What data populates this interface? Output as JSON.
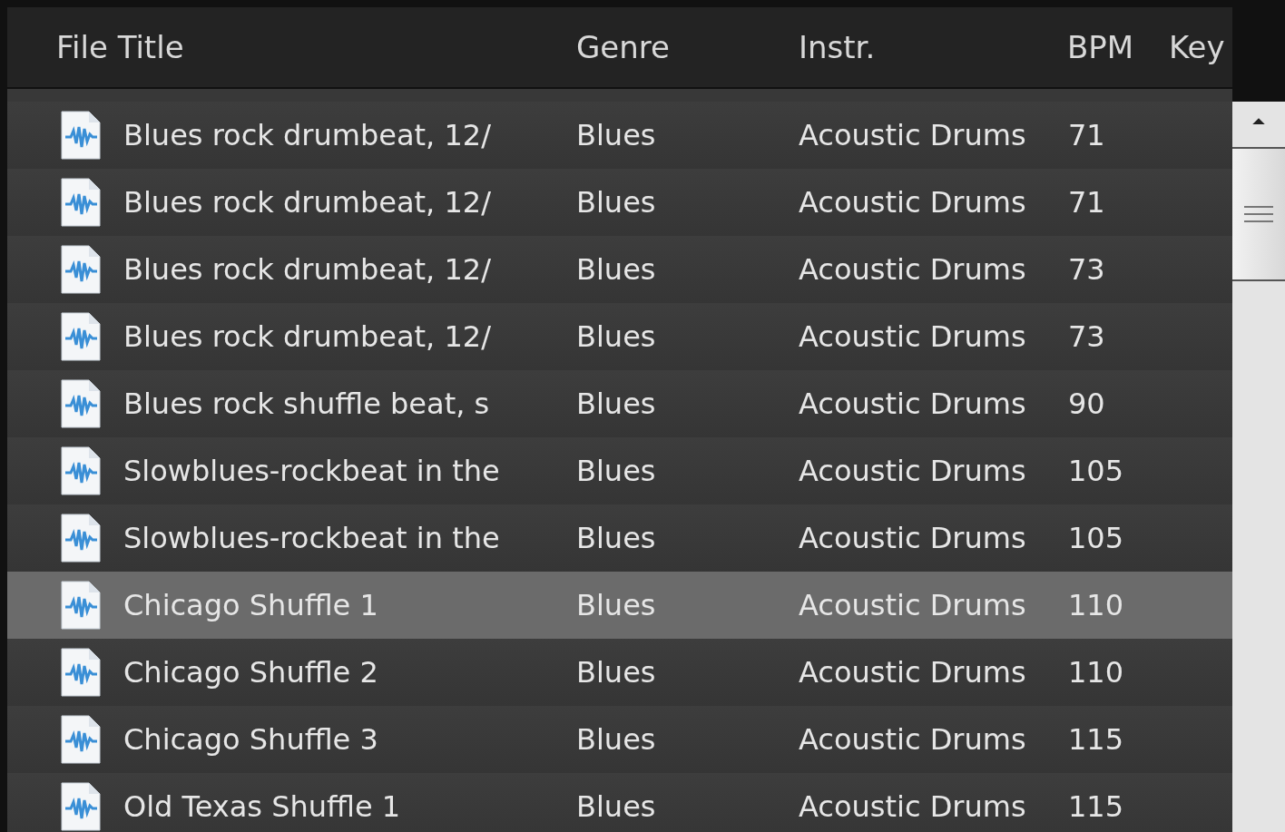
{
  "columns": [
    "File Title",
    "Genre",
    "Instr.",
    "BPM",
    "Key"
  ],
  "rows": [
    {
      "title": "Blues rock drumbeat, 12/",
      "genre": "Blues",
      "instrument": "Acoustic Drums",
      "bpm": "71",
      "selected": false
    },
    {
      "title": "Blues rock drumbeat, 12/",
      "genre": "Blues",
      "instrument": "Acoustic Drums",
      "bpm": "71",
      "selected": false
    },
    {
      "title": "Blues rock drumbeat, 12/",
      "genre": "Blues",
      "instrument": "Acoustic Drums",
      "bpm": "73",
      "selected": false
    },
    {
      "title": "Blues rock drumbeat, 12/",
      "genre": "Blues",
      "instrument": "Acoustic Drums",
      "bpm": "73",
      "selected": false
    },
    {
      "title": "Blues rock shuffle beat, s",
      "genre": "Blues",
      "instrument": "Acoustic Drums",
      "bpm": "90",
      "selected": false
    },
    {
      "title": "Slowblues-rockbeat in the",
      "genre": "Blues",
      "instrument": "Acoustic Drums",
      "bpm": "105",
      "selected": false
    },
    {
      "title": "Slowblues-rockbeat in the",
      "genre": "Blues",
      "instrument": "Acoustic Drums",
      "bpm": "105",
      "selected": false
    },
    {
      "title": "Chicago Shuffle 1",
      "genre": "Blues",
      "instrument": "Acoustic Drums",
      "bpm": "110",
      "selected": true
    },
    {
      "title": "Chicago Shuffle 2",
      "genre": "Blues",
      "instrument": "Acoustic Drums",
      "bpm": "110",
      "selected": false
    },
    {
      "title": "Chicago Shuffle 3",
      "genre": "Blues",
      "instrument": "Acoustic Drums",
      "bpm": "115",
      "selected": false
    },
    {
      "title": "Old Texas Shuffle 1",
      "genre": "Blues",
      "instrument": "Acoustic Drums",
      "bpm": "115",
      "selected": false
    }
  ]
}
